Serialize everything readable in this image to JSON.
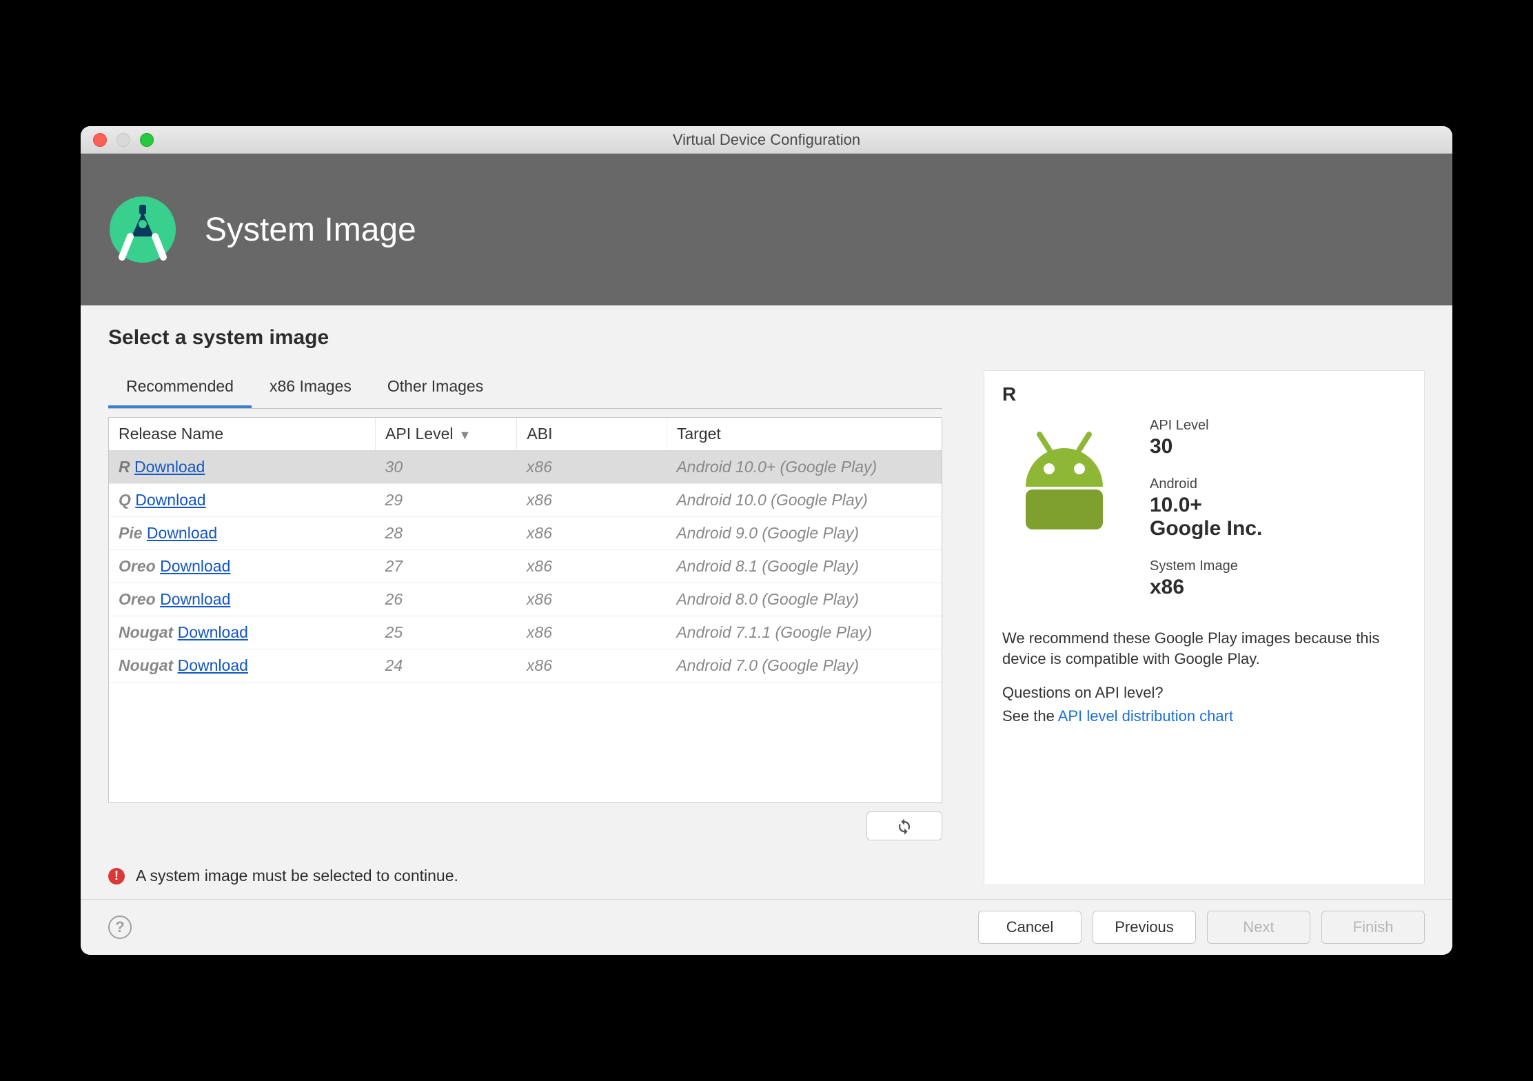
{
  "window": {
    "title": "Virtual Device Configuration"
  },
  "header": {
    "title": "System Image"
  },
  "main": {
    "subtitle": "Select a system image",
    "tabs": [
      {
        "label": "Recommended",
        "active": true
      },
      {
        "label": "x86 Images",
        "active": false
      },
      {
        "label": "Other Images",
        "active": false
      }
    ],
    "columns": {
      "release": "Release Name",
      "api": "API Level",
      "abi": "ABI",
      "target": "Target"
    },
    "sorted_by": "api",
    "rows": [
      {
        "release": "R",
        "download": "Download",
        "api": "30",
        "abi": "x86",
        "target": "Android 10.0+ (Google Play)",
        "selected": true
      },
      {
        "release": "Q",
        "download": "Download",
        "api": "29",
        "abi": "x86",
        "target": "Android 10.0 (Google Play)"
      },
      {
        "release": "Pie",
        "download": "Download",
        "api": "28",
        "abi": "x86",
        "target": "Android 9.0 (Google Play)"
      },
      {
        "release": "Oreo",
        "download": "Download",
        "api": "27",
        "abi": "x86",
        "target": "Android 8.1 (Google Play)"
      },
      {
        "release": "Oreo",
        "download": "Download",
        "api": "26",
        "abi": "x86",
        "target": "Android 8.0 (Google Play)"
      },
      {
        "release": "Nougat",
        "download": "Download",
        "api": "25",
        "abi": "x86",
        "target": "Android 7.1.1 (Google Play)"
      },
      {
        "release": "Nougat",
        "download": "Download",
        "api": "24",
        "abi": "x86",
        "target": "Android 7.0 (Google Play)"
      }
    ],
    "notice": "A system image must be selected to continue."
  },
  "details": {
    "title": "R",
    "api_label": "API Level",
    "api_value": "30",
    "android_label": "Android",
    "android_value": "10.0+",
    "vendor": "Google Inc.",
    "sysimg_label": "System Image",
    "sysimg_value": "x86",
    "recommend": "We recommend these Google Play images because this device is compatible with Google Play.",
    "question": "Questions on API level?",
    "see_prefix": "See the ",
    "link": "API level distribution chart"
  },
  "footer": {
    "cancel": "Cancel",
    "previous": "Previous",
    "next": "Next",
    "finish": "Finish"
  }
}
